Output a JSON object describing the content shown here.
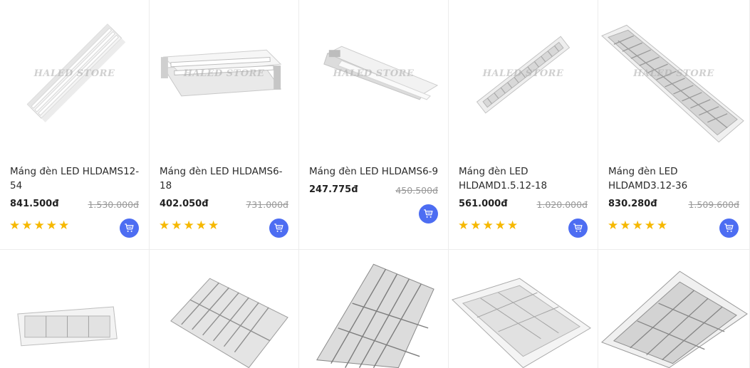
{
  "products": [
    {
      "name": "Máng đèn LED HLDAMS12-54",
      "price": "841.500đ",
      "old_price": "1.530.000đ",
      "watermark": "HALED STORE"
    },
    {
      "name": "Máng đèn LED HLDAMS6-18",
      "price": "402.050đ",
      "old_price": "731.000đ",
      "watermark": "HALED STORE"
    },
    {
      "name": "Máng đèn LED HLDAMS6-9",
      "price": "247.775đ",
      "old_price": "450.500đ",
      "watermark": "HALED STORE"
    },
    {
      "name": "Máng đèn LED HLDAMD1.5.12-18",
      "price": "561.000đ",
      "old_price": "1.020.000đ",
      "watermark": "HALED STORE"
    },
    {
      "name": "Máng đèn LED HLDAMD3.12-36",
      "price": "830.280đ",
      "old_price": "1.509.600đ",
      "watermark": "HALED STORE"
    }
  ],
  "rating_stars": "★★★★★",
  "row2_products": [
    "troffer-1",
    "troffer-2",
    "troffer-3",
    "troffer-4",
    "troffer-5"
  ],
  "cart_icon": "shopping-cart-icon",
  "colors": {
    "accent": "#4d6df2",
    "star": "#f6b800",
    "old_price": "#999999"
  }
}
